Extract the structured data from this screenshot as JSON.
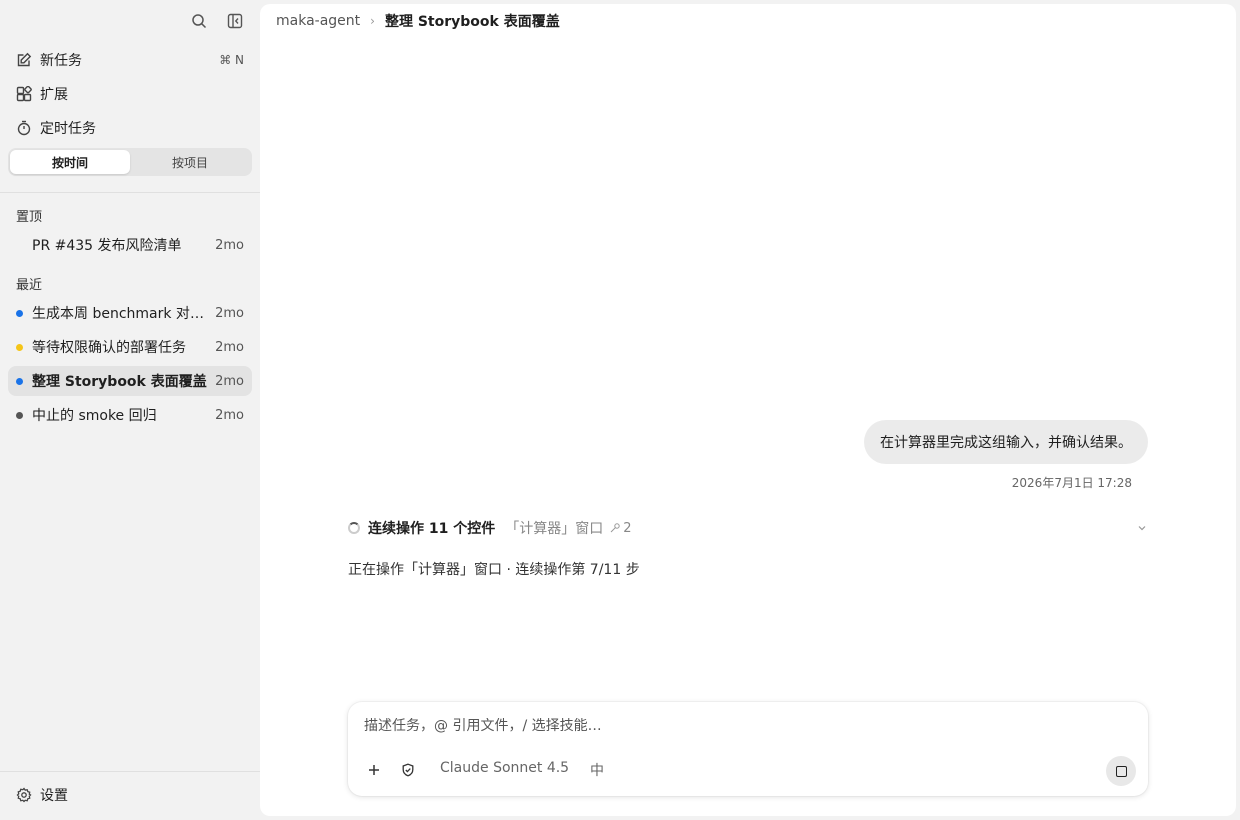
{
  "sidebar": {
    "nav": [
      {
        "label": "新任务",
        "icon": "edit-icon",
        "shortcut": "⌘ N"
      },
      {
        "label": "扩展",
        "icon": "extensions-icon"
      },
      {
        "label": "定时任务",
        "icon": "timer-icon"
      }
    ],
    "segments": [
      "按时间",
      "按项目"
    ],
    "active_segment": "按时间",
    "pinned_label": "置顶",
    "pinned": [
      {
        "name": "PR #435 发布风险清单",
        "age": "2mo"
      }
    ],
    "recent_label": "最近",
    "recent": [
      {
        "name": "生成本周 benchmark 对比报告",
        "age": "2mo",
        "status_color": "#1a73e8"
      },
      {
        "name": "等待权限确认的部署任务",
        "age": "2mo",
        "status_color": "#f5c518"
      },
      {
        "name": "整理 Storybook 表面覆盖",
        "age": "2mo",
        "status_color": "#1a73e8",
        "active": true
      },
      {
        "name": "中止的 smoke 回归",
        "age": "2mo",
        "status_color": "#555555"
      }
    ],
    "settings_label": "设置"
  },
  "header": {
    "root": "maka-agent",
    "current": "整理 Storybook 表面覆盖"
  },
  "conversation": {
    "user_message": "在计算器里完成这组输入，并确认结果。",
    "timestamp": "2026年7月1日 17:28",
    "operation": {
      "title": "连续操作 11 个控件",
      "window": "「计算器」窗口",
      "count": "2",
      "status": "正在操作「计算器」窗口 · 连续操作第 7/11 步"
    }
  },
  "composer": {
    "placeholder": "描述任务，@ 引用文件，/ 选择技能…",
    "model": "Claude Sonnet 4.5",
    "lang": "中"
  }
}
